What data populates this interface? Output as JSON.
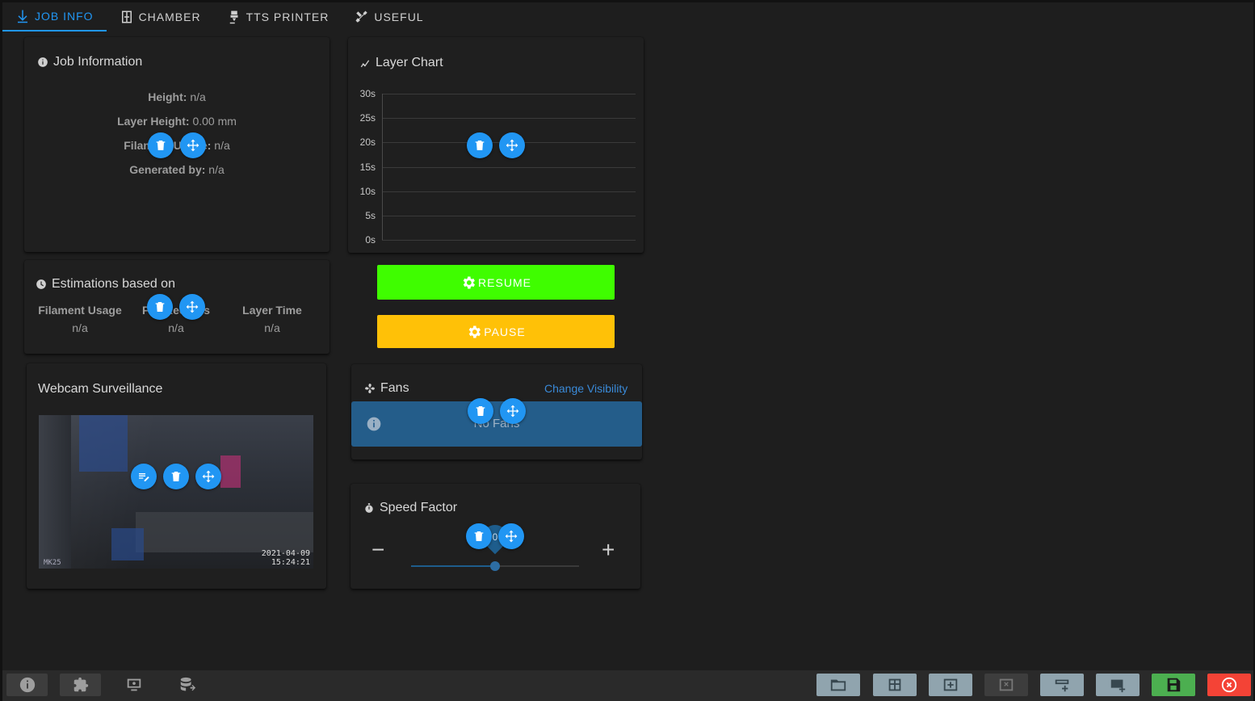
{
  "tabs": [
    {
      "label": "JOB INFO",
      "icon": "download-arrow-icon",
      "active": true
    },
    {
      "label": "CHAMBER",
      "icon": "chamber-icon",
      "active": false
    },
    {
      "label": "TTS PRINTER",
      "icon": "printer-nozzle-icon",
      "active": false
    },
    {
      "label": "USEFUL",
      "icon": "tools-icon",
      "active": false
    }
  ],
  "job_info": {
    "title": "Job Information",
    "height_label": "Height:",
    "height_value": "n/a",
    "layer_height_label": "Layer Height:",
    "layer_height_value": "0.00 mm",
    "filament_label": "Filament Usage:",
    "filament_value": "n/a",
    "generated_label": "Generated by:",
    "generated_value": "n/a"
  },
  "estimations": {
    "title": "Estimations based on",
    "cols": [
      {
        "header": "Filament Usage",
        "value": "n/a"
      },
      {
        "header": "File Records",
        "value": "n/a"
      },
      {
        "header": "Layer Time",
        "value": "n/a"
      }
    ]
  },
  "webcam": {
    "title": "Webcam Surveillance",
    "stamp_date": "2021-04-09",
    "stamp_time": "15:24:21",
    "camera_id": "MK25"
  },
  "layer_chart": {
    "title": "Layer Chart"
  },
  "chart_data": {
    "type": "line",
    "title": "Layer Chart",
    "y_ticks": [
      "30s",
      "25s",
      "20s",
      "15s",
      "10s",
      "5s",
      "0s"
    ],
    "ylim": [
      0,
      30
    ],
    "series": [],
    "grid": true
  },
  "buttons": {
    "resume_label": "RESUME",
    "resume_color": "#3ffd00",
    "pause_label": "PAUSE",
    "pause_color": "#ffc107"
  },
  "fans": {
    "title": "Fans",
    "change_visibility": "Change Visibility",
    "empty_text": "No Fans"
  },
  "speed_factor": {
    "title": "Speed Factor",
    "minus": "−",
    "plus": "+",
    "value_label": "0",
    "level": 0.5
  },
  "colors": {
    "accent": "#2196f3",
    "danger": "#f44336",
    "success": "#4caf50",
    "neutral_btn": "#90a4ae"
  }
}
